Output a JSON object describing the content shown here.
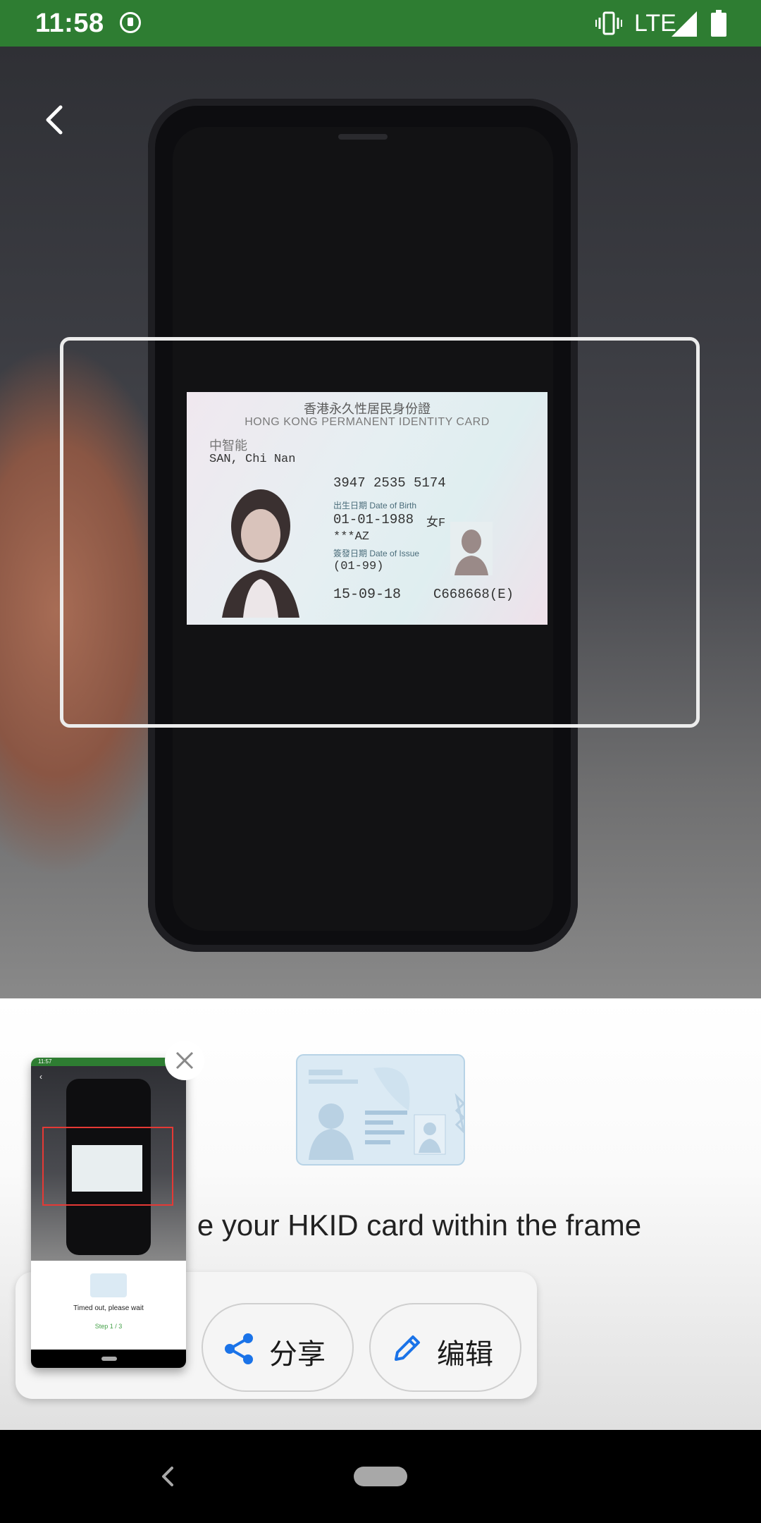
{
  "status_bar": {
    "time": "11:58",
    "network": "LTE",
    "icons": [
      "vpn-key-icon",
      "vibrate-icon",
      "signal-icon",
      "battery-icon"
    ]
  },
  "camera": {
    "id_card": {
      "title_zh": "香港永久性居民身份證",
      "title_en": "HONG KONG PERMANENT IDENTITY CARD",
      "name_zh": "中智能",
      "name_en": "SAN, Chi Nan",
      "number": "3947 2535 5174",
      "dob_label": "出生日期 Date of Birth",
      "dob": "01-01-1988",
      "sex": "女F",
      "symbols": "***AZ",
      "issue_label": "簽發日期 Date of Issue",
      "first_issue": "(01-99)",
      "issue_date": "15-09-18",
      "id_number": "C668668(E)"
    }
  },
  "instruction": {
    "text": "e your HKID card within the frame"
  },
  "share_sheet": {
    "share_label": "分享",
    "edit_label": "编辑"
  },
  "thumbnail": {
    "status_time": "11:57",
    "message": "Timed out, please wait",
    "step": "Step 1 / 3"
  },
  "colors": {
    "status_bar": "#2e7d32",
    "accent_blue": "#1a73e8",
    "frame": "#ececec"
  }
}
